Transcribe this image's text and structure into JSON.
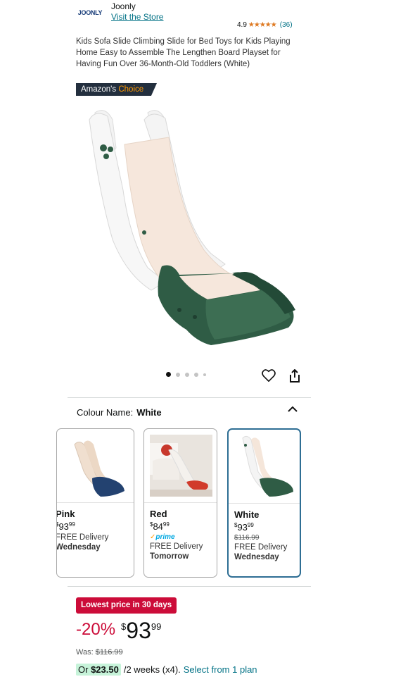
{
  "header": {
    "logo_text": "JOONLY",
    "brand_name": "Joonly",
    "visit_store": "Visit the Store",
    "rating": "4.9",
    "stars": "★★★★★",
    "rating_count": "(36)"
  },
  "product": {
    "title": "Kids Sofa Slide Climbing Slide for Bed Toys for Kids Playing Home Easy to Assemble The Lengthen Board Playset for Having Fun Over 36-Month-Old Toddlers (White)",
    "badge_prefix": "Amazon's",
    "badge_suffix": "Choice",
    "image_dots": 5,
    "active_dot": 0
  },
  "colour": {
    "label": "Colour Name:",
    "selected": "White",
    "options": [
      {
        "name": "Pink",
        "currency": "$",
        "whole": "93",
        "fraction": "99",
        "delivery": "FREE Delivery",
        "day": "Wednesday"
      },
      {
        "name": "Red",
        "currency": "$",
        "whole": "84",
        "fraction": "99",
        "prime": "prime",
        "delivery": "FREE Delivery",
        "day": "Tomorrow"
      },
      {
        "name": "White",
        "currency": "$",
        "whole": "93",
        "fraction": "99",
        "was": "$116.99",
        "delivery": "FREE Delivery",
        "day": "Wednesday"
      }
    ]
  },
  "pricing": {
    "lowest_badge": "Lowest price in 30 days",
    "discount": "-20%",
    "currency": "$",
    "whole": "93",
    "fraction": "99",
    "was_label": "Was:",
    "was_price": "$116.99",
    "or_label": "Or",
    "installment": "$23.50",
    "installment_terms": "/2 weeks (x4).",
    "plan_link": "Select from 1 plan"
  },
  "colors": {
    "accent_link": "#007185",
    "discount_red": "#cc0c39",
    "selected_border": "#2e6e94",
    "slide_green": "#2f5c45",
    "slide_cream": "#f6e7dc"
  }
}
